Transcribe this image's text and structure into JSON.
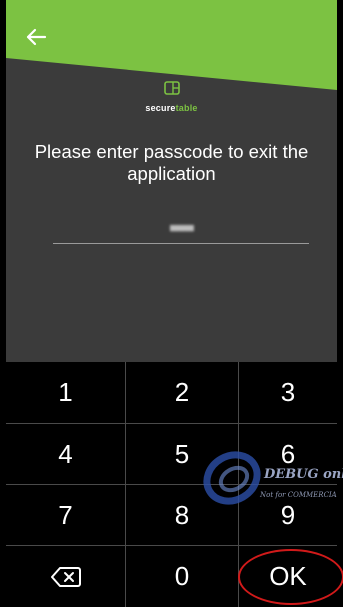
{
  "logo": {
    "prefix": "secure",
    "accent": "table",
    "icon": "tablet-icon"
  },
  "prompt": "Please enter passcode to exit the application",
  "passcode": {
    "masked_value": "■■■■"
  },
  "keypad": {
    "keys": [
      "1",
      "2",
      "3",
      "4",
      "5",
      "6",
      "7",
      "8",
      "9",
      "backspace",
      "0",
      "OK"
    ]
  },
  "watermark": {
    "title": "DEBUG onl",
    "subtitle": "Not for COMMERCIA"
  },
  "colors": {
    "brand_green": "#7cc242",
    "background": "#3b3b3b",
    "keypad": "#000000",
    "highlight": "#d11a1a"
  }
}
